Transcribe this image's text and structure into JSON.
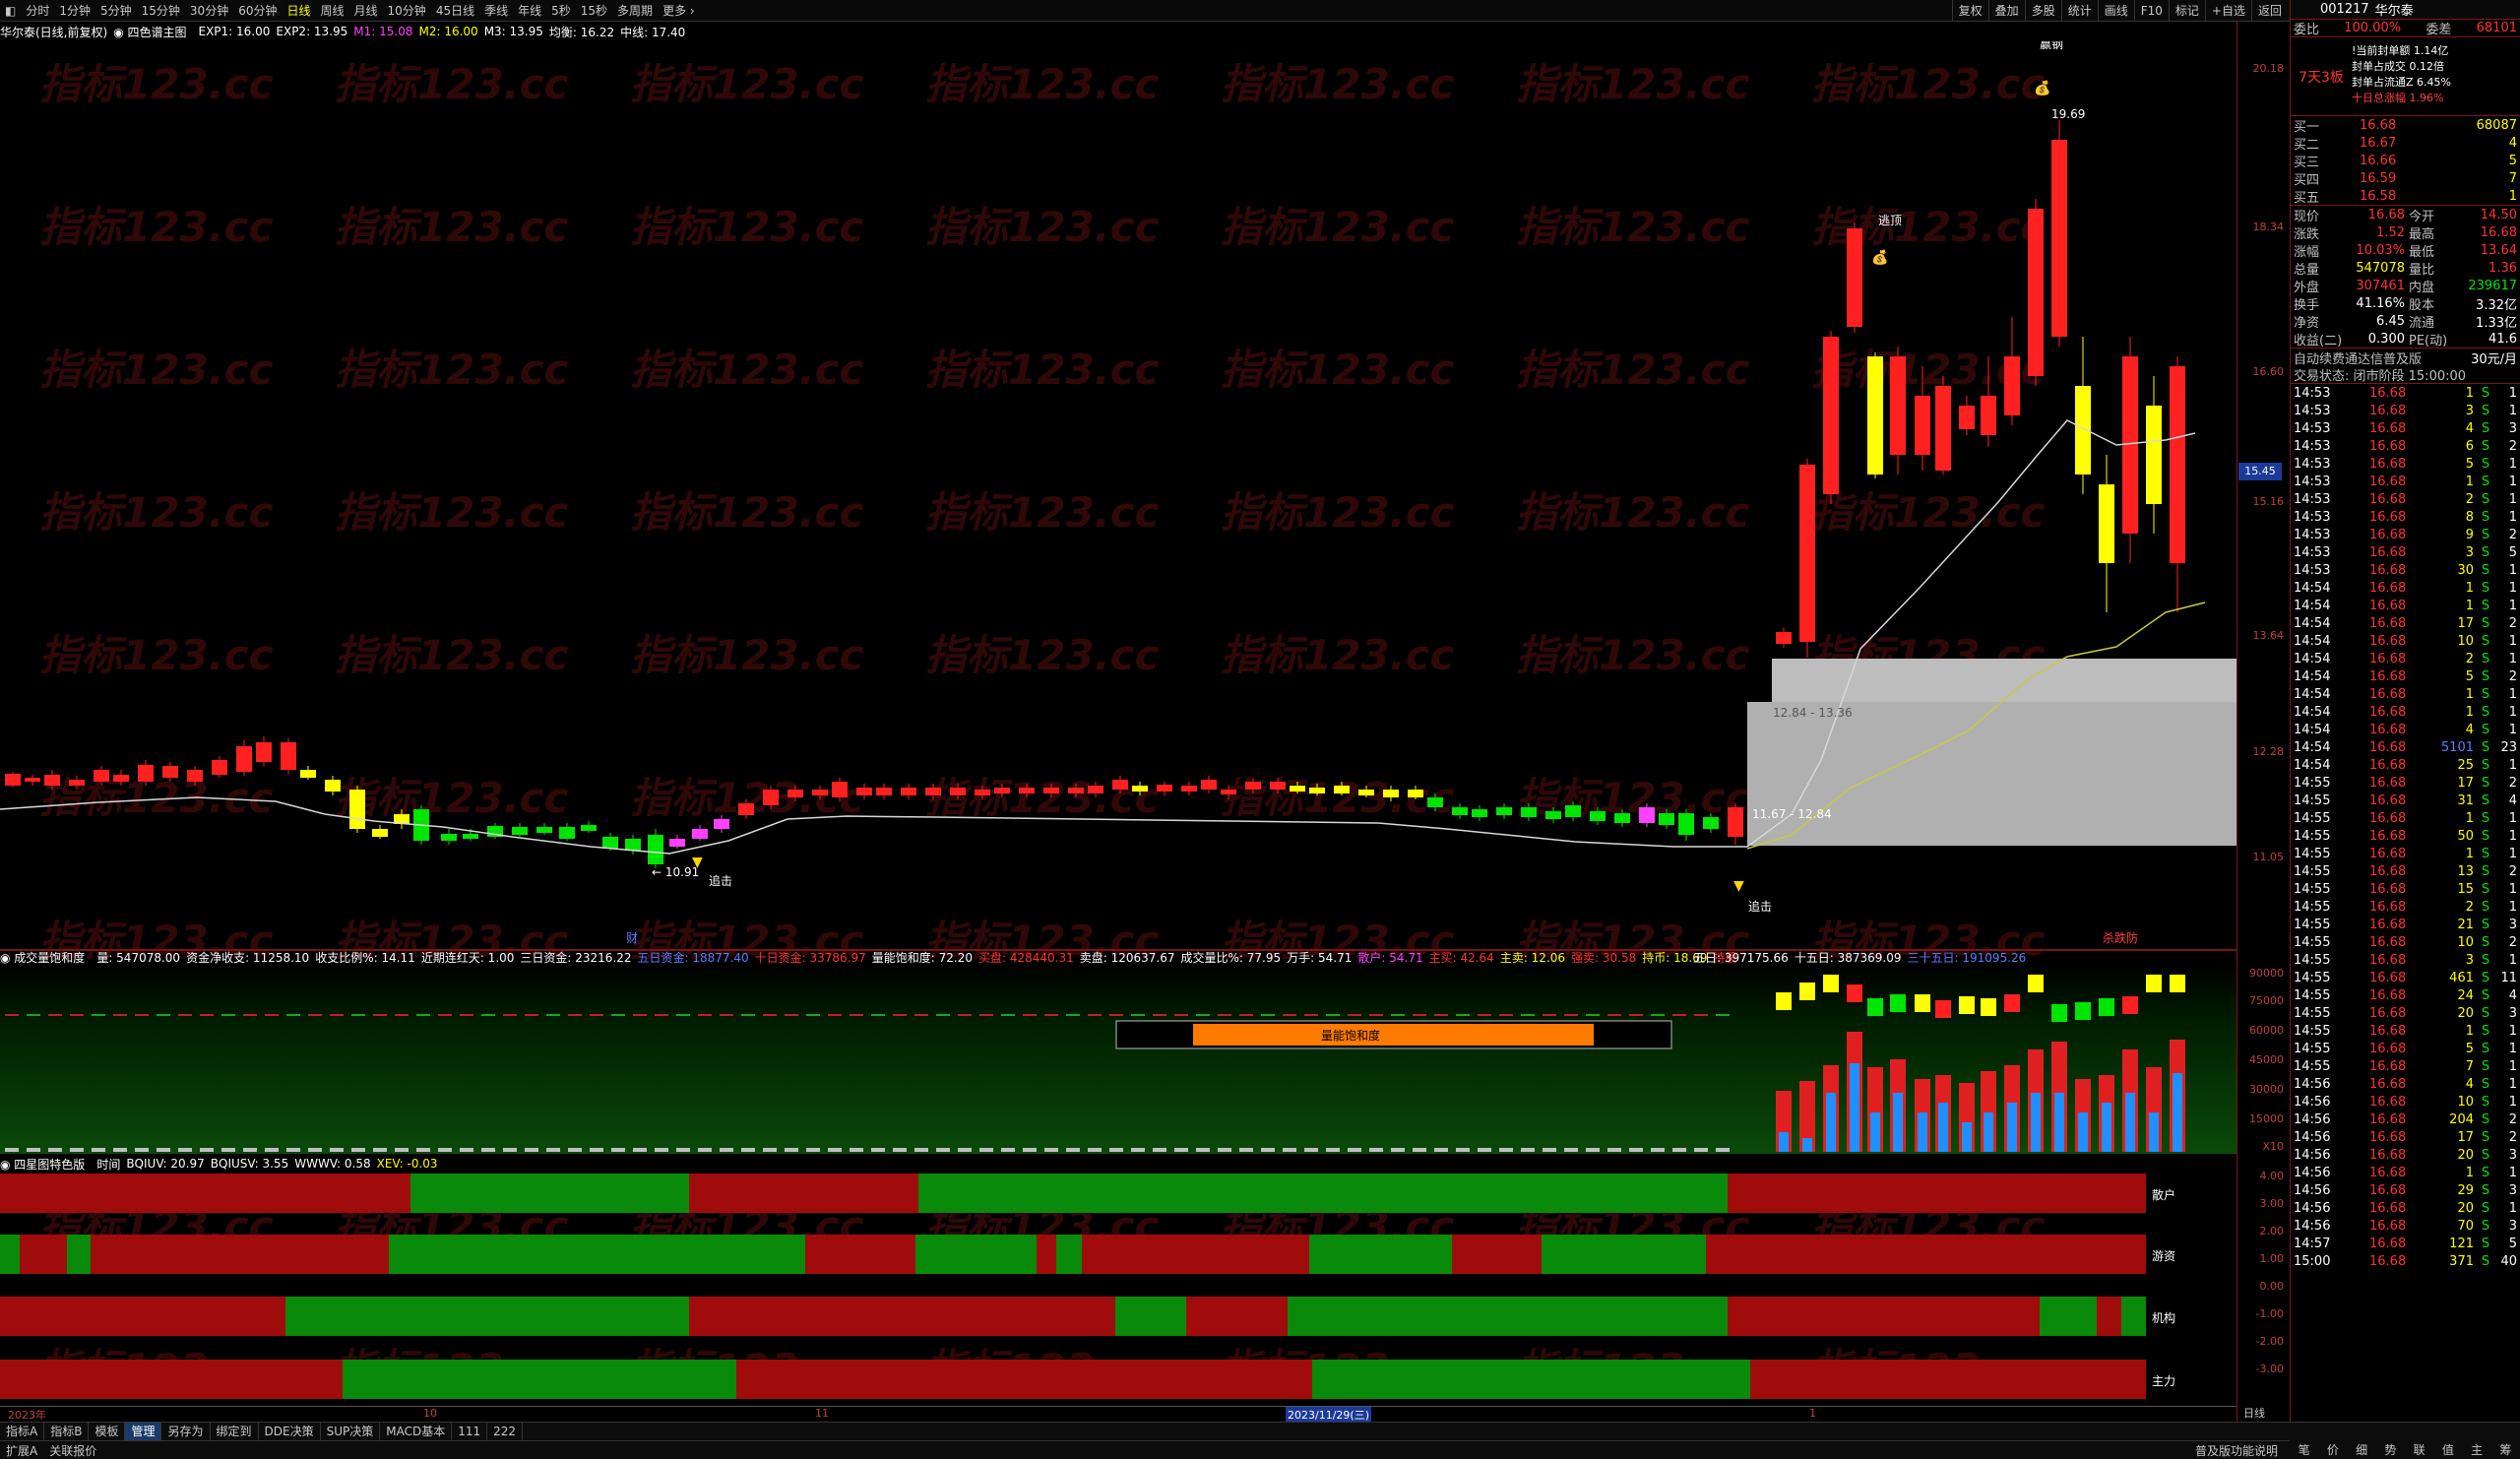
{
  "toolbar": {
    "items": [
      "分时",
      "1分钟",
      "5分钟",
      "15分钟",
      "30分钟",
      "60分钟",
      "日线",
      "周线",
      "月线",
      "10分钟",
      "45日线",
      "季线",
      "年线",
      "5秒",
      "15秒",
      "多周期",
      "更多 ›"
    ],
    "active_index": 6,
    "right": [
      "复权",
      "叠加",
      "多股",
      "统计",
      "画线",
      "F10",
      "标记",
      "+自选",
      "返回"
    ]
  },
  "main_info": {
    "title": "华尔泰(日线,前复权)",
    "indicator_name": "四色谱主图",
    "exp1": "EXP1: 16.00",
    "exp2": "EXP2: 13.95",
    "m1": "M1: 15.08",
    "m2": "M2: 16.00",
    "m3": "M3: 13.95",
    "avg": "均衡: 16.22",
    "mid": "中线: 17.40"
  },
  "watermark": "指标123.cc",
  "main_chart": {
    "y_ticks": [
      "20.18",
      "18.34",
      "16.60",
      "15.16",
      "13.64",
      "12.28",
      "11.05"
    ],
    "current_price_tag": "15.45",
    "annotations": {
      "top_label": "赢钢",
      "escape": "逃顶",
      "peak": "19.69",
      "low": "10.91",
      "chase1": "追击",
      "chase2": "追击",
      "zone_range": "11.67 - 12.84",
      "zone_range2": "12.84 - 13.36",
      "cai": "财",
      "sell": "杀跌防"
    }
  },
  "vol_info": {
    "name": "成交量饱和度",
    "vol": "量: 547078.00",
    "inflow": "资金净收支: 11258.10",
    "ratio": "收支比例%: 14.11",
    "streak": "近期连红天: 1.00",
    "three_day": "三日资金: 23216.22",
    "five_day": "五日资金: 18877.40",
    "ten_day": "十日资金: 33786.97",
    "saturation": "量能饱和度: 72.20",
    "buy": "买盘: 428440.31",
    "sell": "卖盘: 120637.67",
    "vol_ratio": "成交量比%: 77.95",
    "wan": "万手: 54.71",
    "retail": "散户: 54.71",
    "main_buy": "主买: 42.64",
    "main_sell": "主卖: 12.06",
    "strong_sell": "强卖: 30.58",
    "hold": "持币: 18.69",
    "cash": "持股",
    "five_day_right": "五日: 397175.66",
    "fifteen_day_right": "十五日: 387369.09",
    "thirty_day_right": "三十五日: 191095.26",
    "y_ticks": [
      "90000",
      "75000",
      "60000",
      "45000",
      "30000",
      "15000",
      "X10"
    ],
    "bar_label": "量能饱和度"
  },
  "ind_info": {
    "name": "四星图特色版",
    "time": "时间",
    "bqiuv": "BQIUV: 20.97",
    "bqiusv": "BQIUSV: 3.55",
    "wwwv": "WWWV: 0.58",
    "xev": "XEV: -0.03",
    "y_ticks": [
      "4.00",
      "3.00",
      "2.00",
      "1.00",
      "0.00",
      "-1.00",
      "-2.00",
      "-3.00"
    ],
    "row_labels": [
      "散户",
      "游资",
      "机构",
      "主力"
    ]
  },
  "date_axis": {
    "labels": [
      "2023年",
      "10",
      "11",
      "2023/11/29(三)",
      "1"
    ],
    "right_label": "日线"
  },
  "bottom_tabs": [
    "指标A",
    "指标B",
    "模板",
    "管理",
    "另存为",
    "绑定到",
    "DDE决策",
    "SUP决策",
    "MACD基本",
    "111",
    "222"
  ],
  "bottom_active": 3,
  "status": [
    "扩展A",
    "关联报价"
  ],
  "status_right": "普及版功能说明",
  "side": {
    "code": "001217",
    "name": "华尔泰",
    "webi_label": "委比",
    "webi": "100.00%",
    "weicha_label": "委差",
    "weicha": "68101",
    "board": "7天3板",
    "seal_lines": [
      "!当前封单额 1.14亿",
      "封单占成交 0.12倍",
      "封单占流通Z 6.45%",
      "十日总涨幅 1.96%"
    ],
    "bids": [
      {
        "label": "买一",
        "price": "16.68",
        "vol": "68087"
      },
      {
        "label": "买二",
        "price": "16.67",
        "vol": "4"
      },
      {
        "label": "买三",
        "price": "16.66",
        "vol": "5"
      },
      {
        "label": "买四",
        "price": "16.59",
        "vol": "7"
      },
      {
        "label": "买五",
        "price": "16.58",
        "vol": "1"
      }
    ],
    "stats": [
      {
        "l1": "现价",
        "v1": "16.68",
        "l2": "今开",
        "v2": "14.50"
      },
      {
        "l1": "涨跌",
        "v1": "1.52",
        "l2": "最高",
        "v2": "16.68"
      },
      {
        "l1": "涨幅",
        "v1": "10.03%",
        "l2": "最低",
        "v2": "13.64"
      },
      {
        "l1": "总量",
        "v1": "547078",
        "l2": "量比",
        "v2": "1.36"
      },
      {
        "l1": "外盘",
        "v1": "307461",
        "l2": "内盘",
        "v2": "239617"
      },
      {
        "l1": "换手",
        "v1": "41.16%",
        "l2": "股本",
        "v2": "3.32亿"
      },
      {
        "l1": "净资",
        "v1": "6.45",
        "l2": "流通",
        "v2": "1.33亿"
      },
      {
        "l1": "收益(二)",
        "v1": "0.300",
        "l2": "PE(动)",
        "v2": "41.6"
      }
    ],
    "fee_label": "自动续费通达信普及版",
    "fee_value": "30元/月",
    "trade_state": "交易状态: 闭市阶段 15:00:00",
    "ticks": [
      [
        "14:53",
        "16.68",
        "1",
        "S",
        "1"
      ],
      [
        "14:53",
        "16.68",
        "3",
        "S",
        "1"
      ],
      [
        "14:53",
        "16.68",
        "4",
        "S",
        "3"
      ],
      [
        "14:53",
        "16.68",
        "6",
        "S",
        "2"
      ],
      [
        "14:53",
        "16.68",
        "5",
        "S",
        "1"
      ],
      [
        "14:53",
        "16.68",
        "1",
        "S",
        "1"
      ],
      [
        "14:53",
        "16.68",
        "2",
        "S",
        "1"
      ],
      [
        "14:53",
        "16.68",
        "8",
        "S",
        "1"
      ],
      [
        "14:53",
        "16.68",
        "9",
        "S",
        "2"
      ],
      [
        "14:53",
        "16.68",
        "3",
        "S",
        "5"
      ],
      [
        "14:53",
        "16.68",
        "30",
        "S",
        "1"
      ],
      [
        "14:54",
        "16.68",
        "1",
        "S",
        "1"
      ],
      [
        "14:54",
        "16.68",
        "1",
        "S",
        "1"
      ],
      [
        "14:54",
        "16.68",
        "17",
        "S",
        "2"
      ],
      [
        "14:54",
        "16.68",
        "10",
        "S",
        "1"
      ],
      [
        "14:54",
        "16.68",
        "2",
        "S",
        "1"
      ],
      [
        "14:54",
        "16.68",
        "5",
        "S",
        "2"
      ],
      [
        "14:54",
        "16.68",
        "1",
        "S",
        "1"
      ],
      [
        "14:54",
        "16.68",
        "1",
        "S",
        "1"
      ],
      [
        "14:54",
        "16.68",
        "4",
        "S",
        "1"
      ],
      [
        "14:54",
        "16.68",
        "5101",
        "S",
        "23"
      ],
      [
        "14:54",
        "16.68",
        "25",
        "S",
        "1"
      ],
      [
        "14:55",
        "16.68",
        "17",
        "S",
        "2"
      ],
      [
        "14:55",
        "16.68",
        "31",
        "S",
        "4"
      ],
      [
        "14:55",
        "16.68",
        "1",
        "S",
        "1"
      ],
      [
        "14:55",
        "16.68",
        "50",
        "S",
        "1"
      ],
      [
        "14:55",
        "16.68",
        "1",
        "S",
        "1"
      ],
      [
        "14:55",
        "16.68",
        "13",
        "S",
        "2"
      ],
      [
        "14:55",
        "16.68",
        "15",
        "S",
        "1"
      ],
      [
        "14:55",
        "16.68",
        "2",
        "S",
        "1"
      ],
      [
        "14:55",
        "16.68",
        "21",
        "S",
        "3"
      ],
      [
        "14:55",
        "16.68",
        "10",
        "S",
        "2"
      ],
      [
        "14:55",
        "16.68",
        "3",
        "S",
        "1"
      ],
      [
        "14:55",
        "16.68",
        "461",
        "S",
        "11"
      ],
      [
        "14:55",
        "16.68",
        "24",
        "S",
        "4"
      ],
      [
        "14:55",
        "16.68",
        "20",
        "S",
        "3"
      ],
      [
        "14:55",
        "16.68",
        "1",
        "S",
        "1"
      ],
      [
        "14:55",
        "16.68",
        "5",
        "S",
        "1"
      ],
      [
        "14:55",
        "16.68",
        "7",
        "S",
        "1"
      ],
      [
        "14:56",
        "16.68",
        "4",
        "S",
        "1"
      ],
      [
        "14:56",
        "16.68",
        "10",
        "S",
        "1"
      ],
      [
        "14:56",
        "16.68",
        "204",
        "S",
        "2"
      ],
      [
        "14:56",
        "16.68",
        "17",
        "S",
        "2"
      ],
      [
        "14:56",
        "16.68",
        "20",
        "S",
        "3"
      ],
      [
        "14:56",
        "16.68",
        "1",
        "S",
        "1"
      ],
      [
        "14:56",
        "16.68",
        "29",
        "S",
        "3"
      ],
      [
        "14:56",
        "16.68",
        "20",
        "S",
        "1"
      ],
      [
        "14:56",
        "16.68",
        "70",
        "S",
        "3"
      ],
      [
        "14:57",
        "16.68",
        "121",
        "S",
        "5"
      ],
      [
        "15:00",
        "16.68",
        "371",
        "S",
        "40"
      ]
    ],
    "bottom_icons": [
      "笔",
      "价",
      "细",
      "势",
      "联",
      "值",
      "主",
      "筹"
    ]
  },
  "colors": {
    "up": "#ff3232",
    "down": "#00e600",
    "yellow": "#ffff00",
    "magenta": "#ff40ff",
    "panel_red": "#a00c0c",
    "panel_green": "#0a8a0a"
  }
}
